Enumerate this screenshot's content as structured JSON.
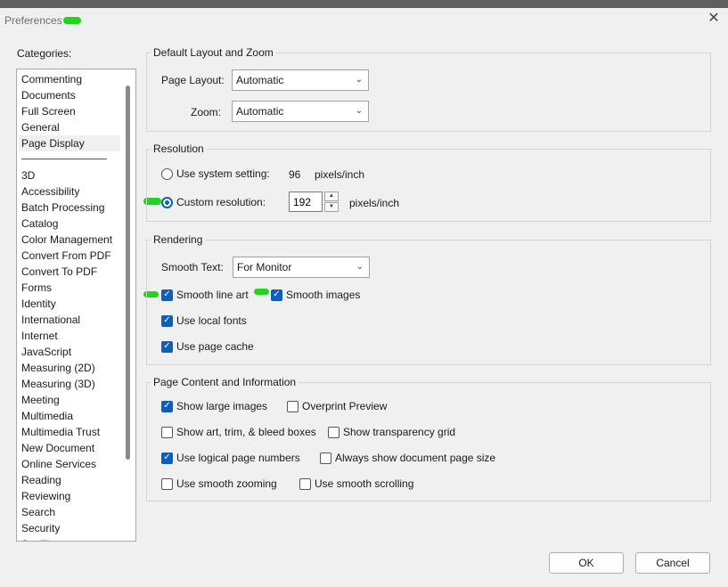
{
  "window": {
    "title": "Preferences"
  },
  "categories": {
    "label": "Categories:",
    "top_items": [
      "Commenting",
      "Documents",
      "Full Screen",
      "General",
      "Page Display"
    ],
    "selected": "Page Display",
    "items": [
      "3D",
      "Accessibility",
      "Batch Processing",
      "Catalog",
      "Color Management",
      "Convert From PDF",
      "Convert To PDF",
      "Forms",
      "Identity",
      "International",
      "Internet",
      "JavaScript",
      "Measuring (2D)",
      "Measuring (3D)",
      "Meeting",
      "Multimedia",
      "Multimedia Trust",
      "New Document",
      "Online Services",
      "Reading",
      "Reviewing",
      "Search",
      "Security",
      "Spelling"
    ]
  },
  "layout_zoom": {
    "title": "Default Layout and Zoom",
    "page_layout_label": "Page Layout:",
    "page_layout_value": "Automatic",
    "zoom_label": "Zoom:",
    "zoom_value": "Automatic"
  },
  "resolution": {
    "title": "Resolution",
    "system_label": "Use system setting:",
    "system_value": "96",
    "system_unit": "pixels/inch",
    "custom_label": "Custom resolution:",
    "custom_value": "192",
    "custom_unit": "pixels/inch",
    "selected": "custom"
  },
  "rendering": {
    "title": "Rendering",
    "smooth_text_label": "Smooth Text:",
    "smooth_text_value": "For Monitor",
    "smooth_line_art": "Smooth line art",
    "smooth_images": "Smooth images",
    "use_local_fonts": "Use local fonts",
    "use_page_cache": "Use page cache"
  },
  "content_info": {
    "title": "Page Content and Information",
    "show_large_images": "Show large images",
    "overprint_preview": "Overprint Preview",
    "show_art_trim": "Show art, trim, & bleed boxes",
    "show_transparency_grid": "Show transparency grid",
    "use_logical_page_numbers": "Use logical page numbers",
    "always_show_page_size": "Always show document page size",
    "use_smooth_zooming": "Use smooth zooming",
    "use_smooth_scrolling": "Use smooth scrolling"
  },
  "buttons": {
    "ok": "OK",
    "cancel": "Cancel"
  },
  "colors": {
    "accent": "#0f5fb8",
    "highlighter": "#22d41e"
  }
}
